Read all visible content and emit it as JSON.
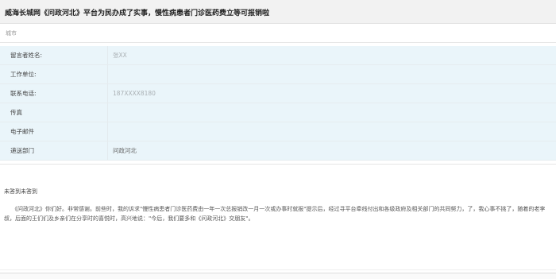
{
  "page": {
    "title": "威海长城网《问政河北》平台为民办成了实事，慢性病患者门诊医药费立等可报销啦",
    "meta": "城市"
  },
  "info": {
    "rows": [
      {
        "label": "留言者姓名:",
        "value": "张XX",
        "blurred": true
      },
      {
        "label": "工作单位:",
        "value": "",
        "blurred": false
      },
      {
        "label": "联系电话:",
        "value": "187XXXX8180",
        "blurred": true
      },
      {
        "label": "传真",
        "value": "",
        "blurred": false
      },
      {
        "label": "电子邮件",
        "value": "",
        "blurred": false
      },
      {
        "label": "递送部门",
        "value": "问政河北",
        "blurred": false
      }
    ]
  },
  "reply": {
    "heading": "未答到未答到",
    "body": "《问政河北》你们好。非常感谢。前些时，我的诉求\"慢性病患者门诊医药费由一年一次总报销改一月一次或办事时就报\"提示后，经过寻平台牵线付出和各级政府及相关部门的共同努力，了，我心事不挑了，随着的老李叔，后面的王们们及乡亲们在分享时的喜悦时，高兴地说：\"今后，我们要多和《问政河北》交朋友\"。"
  }
}
